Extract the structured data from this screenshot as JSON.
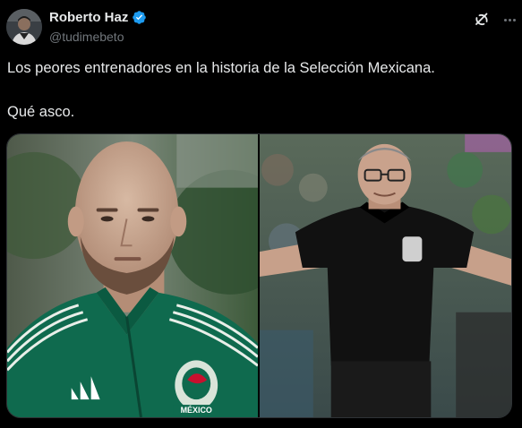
{
  "author": {
    "display_name": "Roberto Haz",
    "handle": "@tudimebeto",
    "verified": true,
    "avatar_icon": "user-avatar"
  },
  "actions": {
    "grok_icon": "grok-icon",
    "more_icon": "more-options-icon"
  },
  "tweet": {
    "line1": "Los peores entrenadores en la historia de la Selección Mexicana.",
    "line2": "Qué asco."
  },
  "media": {
    "photos": [
      {
        "icon": "photo-bald-man-green-jacket"
      },
      {
        "icon": "photo-coach-black-shirt"
      }
    ],
    "jacket_crest_text": "MÉXICO"
  },
  "colors": {
    "background": "#000000",
    "text": "#e7e9ea",
    "secondary": "#71767b",
    "verified": "#1d9bf0",
    "jacket_green": "#0f6a4e"
  }
}
